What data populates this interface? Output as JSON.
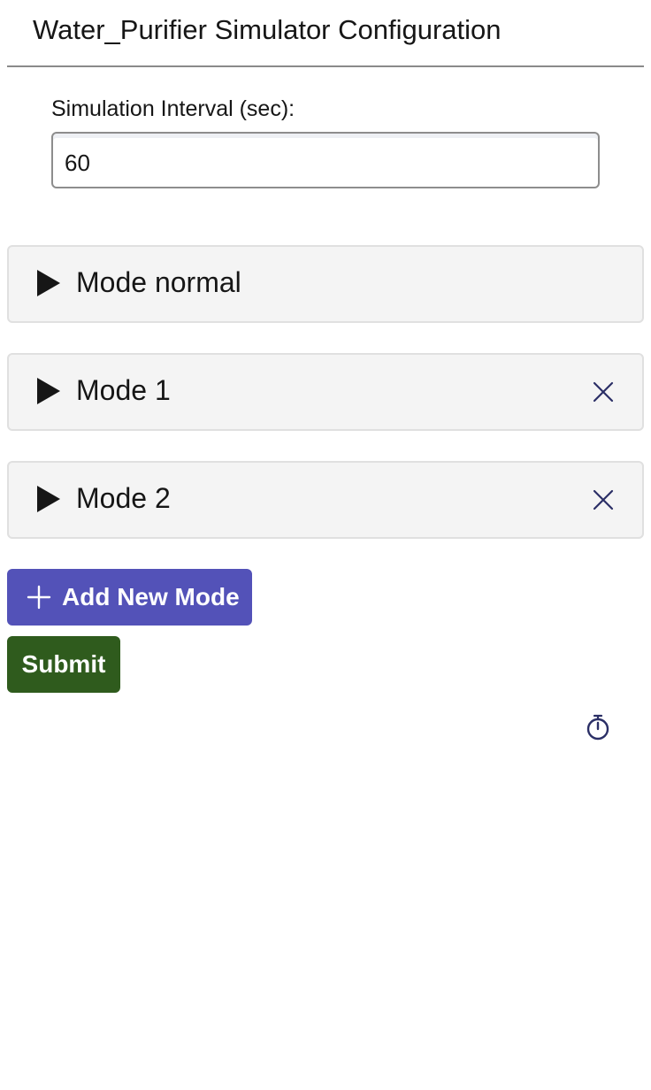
{
  "header": {
    "title": "Water_Purifier Simulator Configuration"
  },
  "interval": {
    "label": "Simulation Interval (sec):",
    "value": "60"
  },
  "modes": [
    {
      "label": "Mode normal",
      "removable": false
    },
    {
      "label": "Mode 1",
      "removable": true
    },
    {
      "label": "Mode 2",
      "removable": true
    }
  ],
  "actions": {
    "add_mode_label": "Add New Mode",
    "submit_label": "Submit"
  },
  "colors": {
    "add_button": "#5352b8",
    "submit_button": "#2f5b1d",
    "close_icon": "#2b2f66",
    "timer_icon": "#2b2f66"
  },
  "icons": {
    "expand": "caret-right-icon",
    "remove": "close-icon",
    "add": "plus-icon",
    "timer": "stopwatch-icon"
  }
}
